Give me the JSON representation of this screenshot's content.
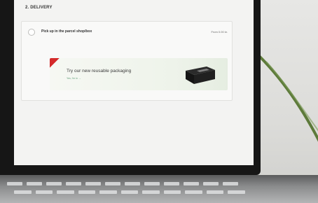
{
  "delivery": {
    "section_title": "2. DELIVERY",
    "option": {
      "label": "Pick up in the parcel shop/box",
      "price": "From 0.00 kr."
    },
    "promo": {
      "title": "Try our new reusable packaging",
      "link": "Yes, I'm in →"
    }
  },
  "colors": {
    "accent_green": "#5b9b74",
    "ribbon_red": "#d42a2a"
  },
  "icons": {
    "radio": "radio-unselected-icon",
    "ribbon": "corner-ribbon-icon",
    "box": "reusable-box-image"
  }
}
